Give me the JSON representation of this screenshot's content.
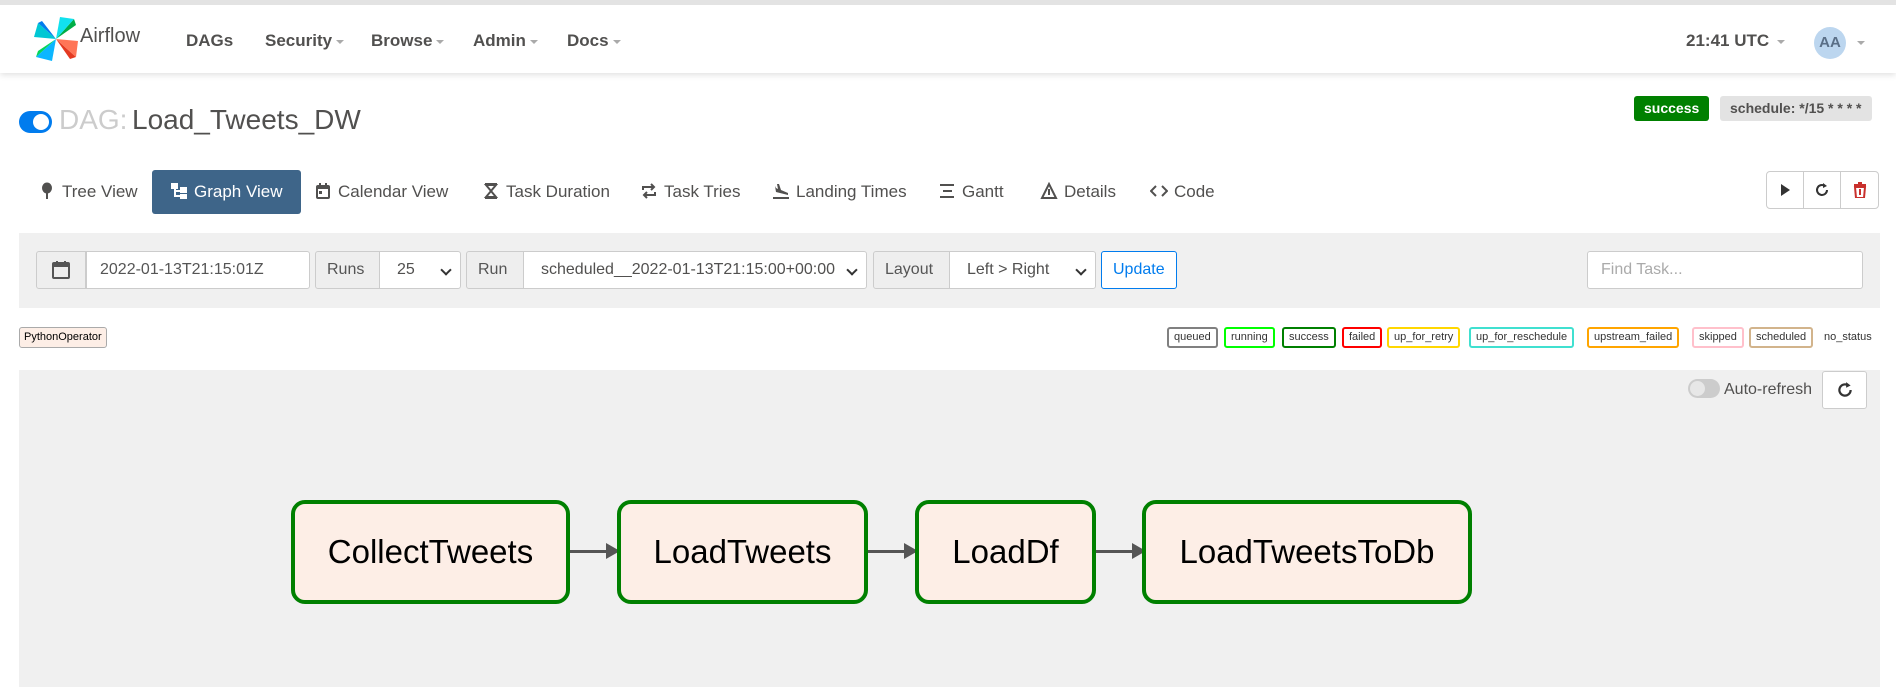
{
  "navbar": {
    "brand": "Airflow",
    "items": [
      {
        "label": "DAGs",
        "dropdown": false
      },
      {
        "label": "Security",
        "dropdown": true
      },
      {
        "label": "Browse",
        "dropdown": true
      },
      {
        "label": "Admin",
        "dropdown": true
      },
      {
        "label": "Docs",
        "dropdown": true
      }
    ],
    "time": "21:41 UTC",
    "user_initials": "AA"
  },
  "dag": {
    "prefix": "DAG:",
    "name": "Load_Tweets_DW",
    "paused": false,
    "state_badge": "success",
    "schedule_badge": "schedule: */15 * * * *"
  },
  "tabs": [
    {
      "label": "Tree View",
      "icon": "tree-icon",
      "active": false
    },
    {
      "label": "Graph View",
      "icon": "graph-icon",
      "active": true
    },
    {
      "label": "Calendar View",
      "icon": "calendar-icon",
      "active": false
    },
    {
      "label": "Task Duration",
      "icon": "hourglass-icon",
      "active": false
    },
    {
      "label": "Task Tries",
      "icon": "repeat-icon",
      "active": false
    },
    {
      "label": "Landing Times",
      "icon": "landing-icon",
      "active": false
    },
    {
      "label": "Gantt",
      "icon": "gantt-icon",
      "active": false
    },
    {
      "label": "Details",
      "icon": "details-icon",
      "active": false
    },
    {
      "label": "Code",
      "icon": "code-icon",
      "active": false
    }
  ],
  "actions": {
    "trigger_icon": "play-icon",
    "refresh_icon": "refresh-icon",
    "delete_icon": "trash-icon"
  },
  "filters": {
    "date_value": "2022-01-13T21:15:01Z",
    "runs_label": "Runs",
    "runs_value": "25",
    "run_label": "Run",
    "run_value": "scheduled__2022-01-13T21:15:00+00:00",
    "layout_label": "Layout",
    "layout_value": "Left > Right",
    "update_label": "Update",
    "find_placeholder": "Find Task..."
  },
  "operator_legend": "PythonOperator",
  "status_legend": [
    {
      "label": "queued",
      "color": "#808080"
    },
    {
      "label": "running",
      "color": "#00ff00"
    },
    {
      "label": "success",
      "color": "#008000"
    },
    {
      "label": "failed",
      "color": "#ff0000"
    },
    {
      "label": "up_for_retry",
      "color": "#ffd700"
    },
    {
      "label": "up_for_reschedule",
      "color": "#40e0d0"
    },
    {
      "label": "upstream_failed",
      "color": "#ffa500"
    },
    {
      "label": "skipped",
      "color": "#ffc0cb"
    },
    {
      "label": "scheduled",
      "color": "#d2b48c"
    },
    {
      "label": "no_status",
      "color": ""
    }
  ],
  "graph": {
    "auto_refresh_label": "Auto-refresh",
    "auto_refresh_on": false,
    "tasks": [
      {
        "id": "CollectTweets",
        "state": "success"
      },
      {
        "id": "LoadTweets",
        "state": "success"
      },
      {
        "id": "LoadDf",
        "state": "success"
      },
      {
        "id": "LoadTweetsToDb",
        "state": "success"
      }
    ]
  }
}
